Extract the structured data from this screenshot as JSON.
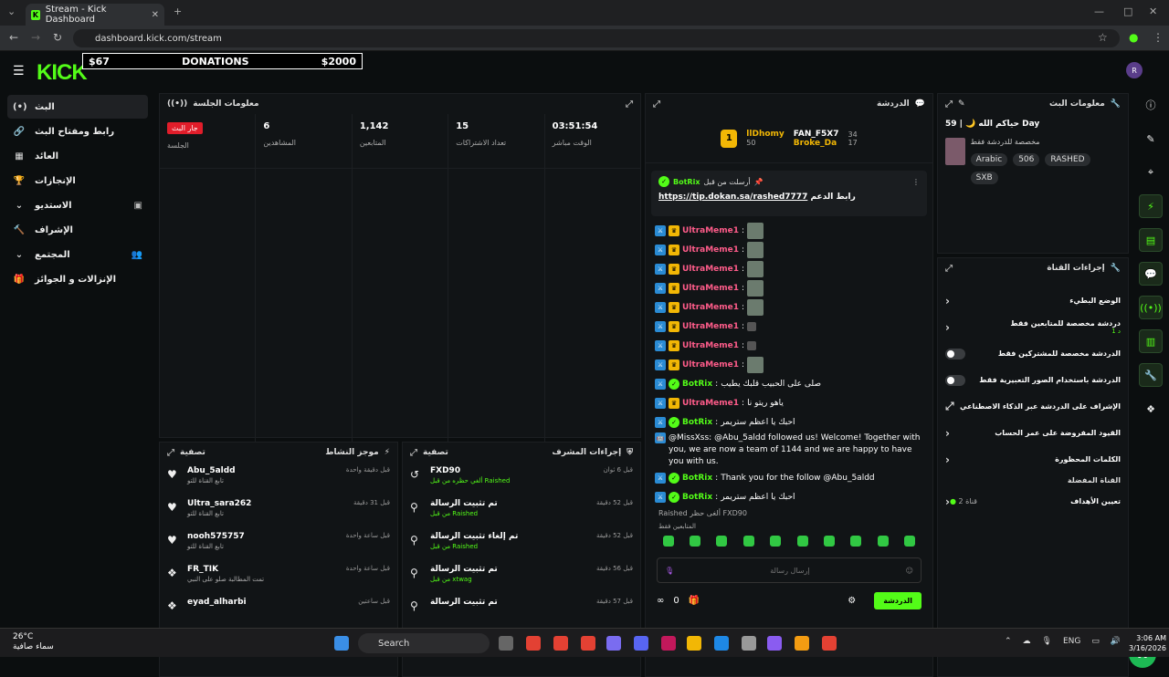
{
  "browser": {
    "tab_title": "Stream - Kick Dashboard",
    "url": "dashboard.kick.com/stream"
  },
  "topbar": {
    "logo": "KICK",
    "donations": {
      "left": "$67",
      "center": "DONATIONS",
      "right": "$2000"
    },
    "avatar": "R"
  },
  "sidebar": {
    "items": [
      {
        "label": "البث",
        "icon": "(•)"
      },
      {
        "label": "رابط ومفتاح البث",
        "icon": "🔗"
      },
      {
        "label": "العائد",
        "icon": "▦"
      },
      {
        "label": "الإنجازات",
        "icon": "🏆"
      },
      {
        "label": "الاستديو",
        "icon": "⌄"
      },
      {
        "label": "الإشراف",
        "icon": "🔨"
      },
      {
        "label": "المجتمع",
        "icon": "⌄"
      },
      {
        "label": "الإنزالات و الجوائز",
        "icon": "🎁"
      }
    ]
  },
  "session": {
    "title": "معلومات الجلسة",
    "live_badge": "جار البث",
    "live_label": "الجلسة",
    "stats": [
      {
        "value": "6",
        "label": "المشاهدين"
      },
      {
        "value": "1,142",
        "label": "المتابعين"
      },
      {
        "value": "15",
        "label": "تعداد الاشتراكات"
      },
      {
        "value": "03:51:54",
        "label": "الوقت مباشر"
      }
    ]
  },
  "activity": {
    "title": "موجز النشاط",
    "filter": "تصفية",
    "items": [
      {
        "name": "Abu_5aldd",
        "sub": "تابع القناة للتو",
        "time": "قبل دقيقة واحدة",
        "icon": "♥"
      },
      {
        "name": "Ultra_sara262",
        "sub": "تابع القناة للتو",
        "time": "قبل 31 دقيقة",
        "icon": "♥"
      },
      {
        "name": "nooh575757",
        "sub": "تابع القناة للتو",
        "time": "قبل ساعة واحدة",
        "icon": "♥"
      },
      {
        "name": "FR_TIK",
        "sub": "تمت المطالبة صلو على النبي",
        "time": "قبل ساعة واحدة",
        "icon": "❖"
      },
      {
        "name": "eyad_alharbi",
        "sub": "",
        "time": "قبل ساعتين",
        "icon": "❖"
      }
    ]
  },
  "modact": {
    "title": "إجراءات المشرف",
    "filter": "تصفية",
    "items": [
      {
        "name": "FXD90",
        "sub": "ألغي حظره من قبل Raished",
        "time": "قبل 6 ثوان",
        "icon": "↺"
      },
      {
        "name": "تم تثبيت الرسالة",
        "sub": "من قبل Raished",
        "time": "قبل 52 دقيقة",
        "icon": "⚲"
      },
      {
        "name": "تم إلغاء تثبيت الرسالة",
        "sub": "من قبل Raished",
        "time": "قبل 52 دقيقة",
        "icon": "⚲"
      },
      {
        "name": "تم تثبيت الرسالة",
        "sub": "من قبل xtwag",
        "time": "قبل 56 دقيقة",
        "icon": "⚲"
      },
      {
        "name": "تم تثبيت الرسالة",
        "sub": "",
        "time": "قبل 57 دقيقة",
        "icon": "⚲"
      }
    ]
  },
  "chat": {
    "title": "الدردشة",
    "top": [
      {
        "rank": "1",
        "name": "llDhomy",
        "value": "50"
      },
      {
        "name": "FAN_F5X7",
        "value": "34"
      },
      {
        "name": "Broke_Da",
        "value": "17"
      }
    ],
    "pinned": {
      "head": "أرسلت من قبل",
      "user": "BotRix",
      "label": "رابط الدعم",
      "link": "https://tip.dokan.sa/rashed7777"
    },
    "messages": [
      {
        "user": "UltraMeme1",
        "kind": "pink",
        "text": ""
      },
      {
        "user": "UltraMeme1",
        "kind": "pink",
        "text": ""
      },
      {
        "user": "UltraMeme1",
        "kind": "pink",
        "text": ""
      },
      {
        "user": "UltraMeme1",
        "kind": "pink",
        "text": ""
      },
      {
        "user": "UltraMeme1",
        "kind": "pink",
        "text": ""
      },
      {
        "user": "UltraMeme1",
        "kind": "pink",
        "text": ""
      },
      {
        "user": "UltraMeme1",
        "kind": "pink",
        "text": ""
      },
      {
        "user": "UltraMeme1",
        "kind": "pink",
        "text": ""
      },
      {
        "user": "BotRix",
        "kind": "green",
        "text": "صلى على الحبيب قلبك يطيب"
      },
      {
        "user": "UltraMeme1",
        "kind": "pink",
        "text": "ياهو ريتو نا"
      },
      {
        "user": "BotRix",
        "kind": "green",
        "text": "احبك يا اعظم ستريمر"
      },
      {
        "user": "",
        "kind": "sys",
        "text": "@MissXss: @Abu_5aldd followed us! Welcome! Together with you, we are now a team of 1144 and we are happy to have you with us."
      },
      {
        "user": "BotRix",
        "kind": "green",
        "text": "Thank you for the follow @Abu_5aldd"
      },
      {
        "user": "BotRix",
        "kind": "green",
        "text": "احبك يا اعظم ستريمر"
      }
    ],
    "raid": "Raished ألغى حظر FXD90",
    "subs_only": "المتابعين فقط",
    "input_placeholder": "إرسال رسالة",
    "count": "0",
    "send": "الدردشة"
  },
  "info": {
    "title": "معلومات البث",
    "stream_title": "حياكم الله 🌙 | 59 Day",
    "category": "مخصصة للدردشة فقط",
    "tags": [
      "Arabic",
      "506",
      "RASHED",
      "SXB"
    ]
  },
  "actions": {
    "title": "إجراءات القناة",
    "rows": [
      {
        "label": "الوضع البطيء",
        "type": "chev",
        "sub": ""
      },
      {
        "label": "دردشة مخصصة للمتابعين فقط",
        "type": "chev",
        "sub": "د 1"
      },
      {
        "label": "الدردشة مخصصة للمشتركين فقط",
        "type": "toggle",
        "sub": ""
      },
      {
        "label": "الدردشة باستخدام الصور التعبيرية فقط",
        "type": "toggle",
        "sub": ""
      },
      {
        "label": "الإشراف على الدردشة عبر الذكاء الاصطناعي",
        "type": "ext",
        "sub": ""
      },
      {
        "label": "القيود المفروضة على عمر الحساب",
        "type": "chev",
        "sub": ""
      },
      {
        "label": "الكلمات المحظورة",
        "type": "chev",
        "sub": ""
      }
    ],
    "fav_title": "القناة المفضلة",
    "goals": "تعيين الأهداف",
    "goals_value": "قناة 2"
  },
  "taskbar": {
    "temp": "26°C",
    "weather": "سماء صافية",
    "search": "Search",
    "lang": "ENG",
    "time": "3:06 AM",
    "date": "3/16/2026"
  }
}
